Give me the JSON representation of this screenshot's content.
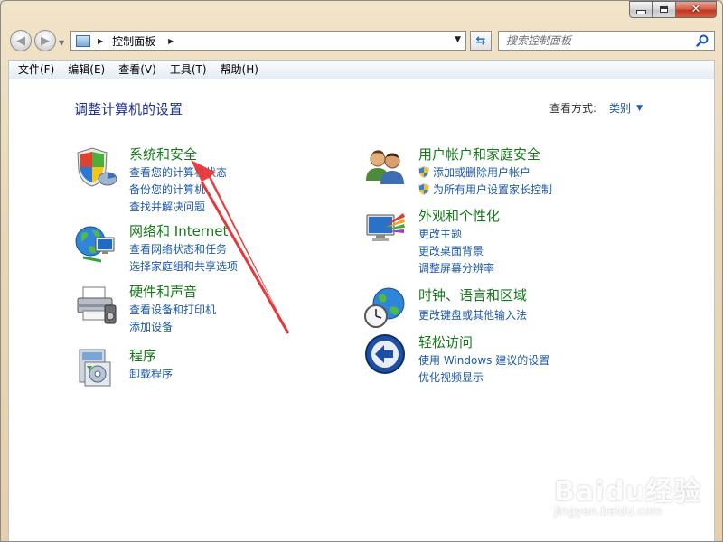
{
  "window": {
    "controls": {
      "minimize": "minimize-icon",
      "maximize": "maximize-icon",
      "close": "close-icon"
    }
  },
  "address": {
    "path": "控制面板",
    "search_placeholder": "搜索控制面板"
  },
  "menu": [
    {
      "label": "文件(F)"
    },
    {
      "label": "编辑(E)"
    },
    {
      "label": "查看(V)"
    },
    {
      "label": "工具(T)"
    },
    {
      "label": "帮助(H)"
    }
  ],
  "page": {
    "title": "调整计算机的设置",
    "view_by_label": "查看方式:",
    "view_by_value": "类别"
  },
  "categories": {
    "system": {
      "title": "系统和安全",
      "links": [
        "查看您的计算机状态",
        "备份您的计算机",
        "查找并解决问题"
      ],
      "icon": "shield-icon"
    },
    "network": {
      "title": "网络和 Internet",
      "links": [
        "查看网络状态和任务",
        "选择家庭组和共享选项"
      ],
      "icon": "globe-network-icon"
    },
    "hardware": {
      "title": "硬件和声音",
      "links": [
        "查看设备和打印机",
        "添加设备"
      ],
      "icon": "printer-icon"
    },
    "programs": {
      "title": "程序",
      "links": [
        "卸载程序"
      ],
      "icon": "programs-icon"
    },
    "users": {
      "title": "用户帐户和家庭安全",
      "links": [
        "添加或删除用户帐户",
        "为所有用户设置家长控制"
      ],
      "icon": "users-icon"
    },
    "appearance": {
      "title": "外观和个性化",
      "links": [
        "更改主题",
        "更改桌面背景",
        "调整屏幕分辨率"
      ],
      "icon": "monitor-palette-icon"
    },
    "clock": {
      "title": "时钟、语言和区域",
      "links": [
        "更改键盘或其他输入法"
      ],
      "icon": "clock-globe-icon"
    },
    "ease": {
      "title": "轻松访问",
      "links": [
        "使用 Windows 建议的设置",
        "优化视频显示"
      ],
      "icon": "ease-of-access-icon"
    }
  },
  "watermark": {
    "main": "Baidu经验",
    "sub": "jingyan.baidu.com"
  }
}
